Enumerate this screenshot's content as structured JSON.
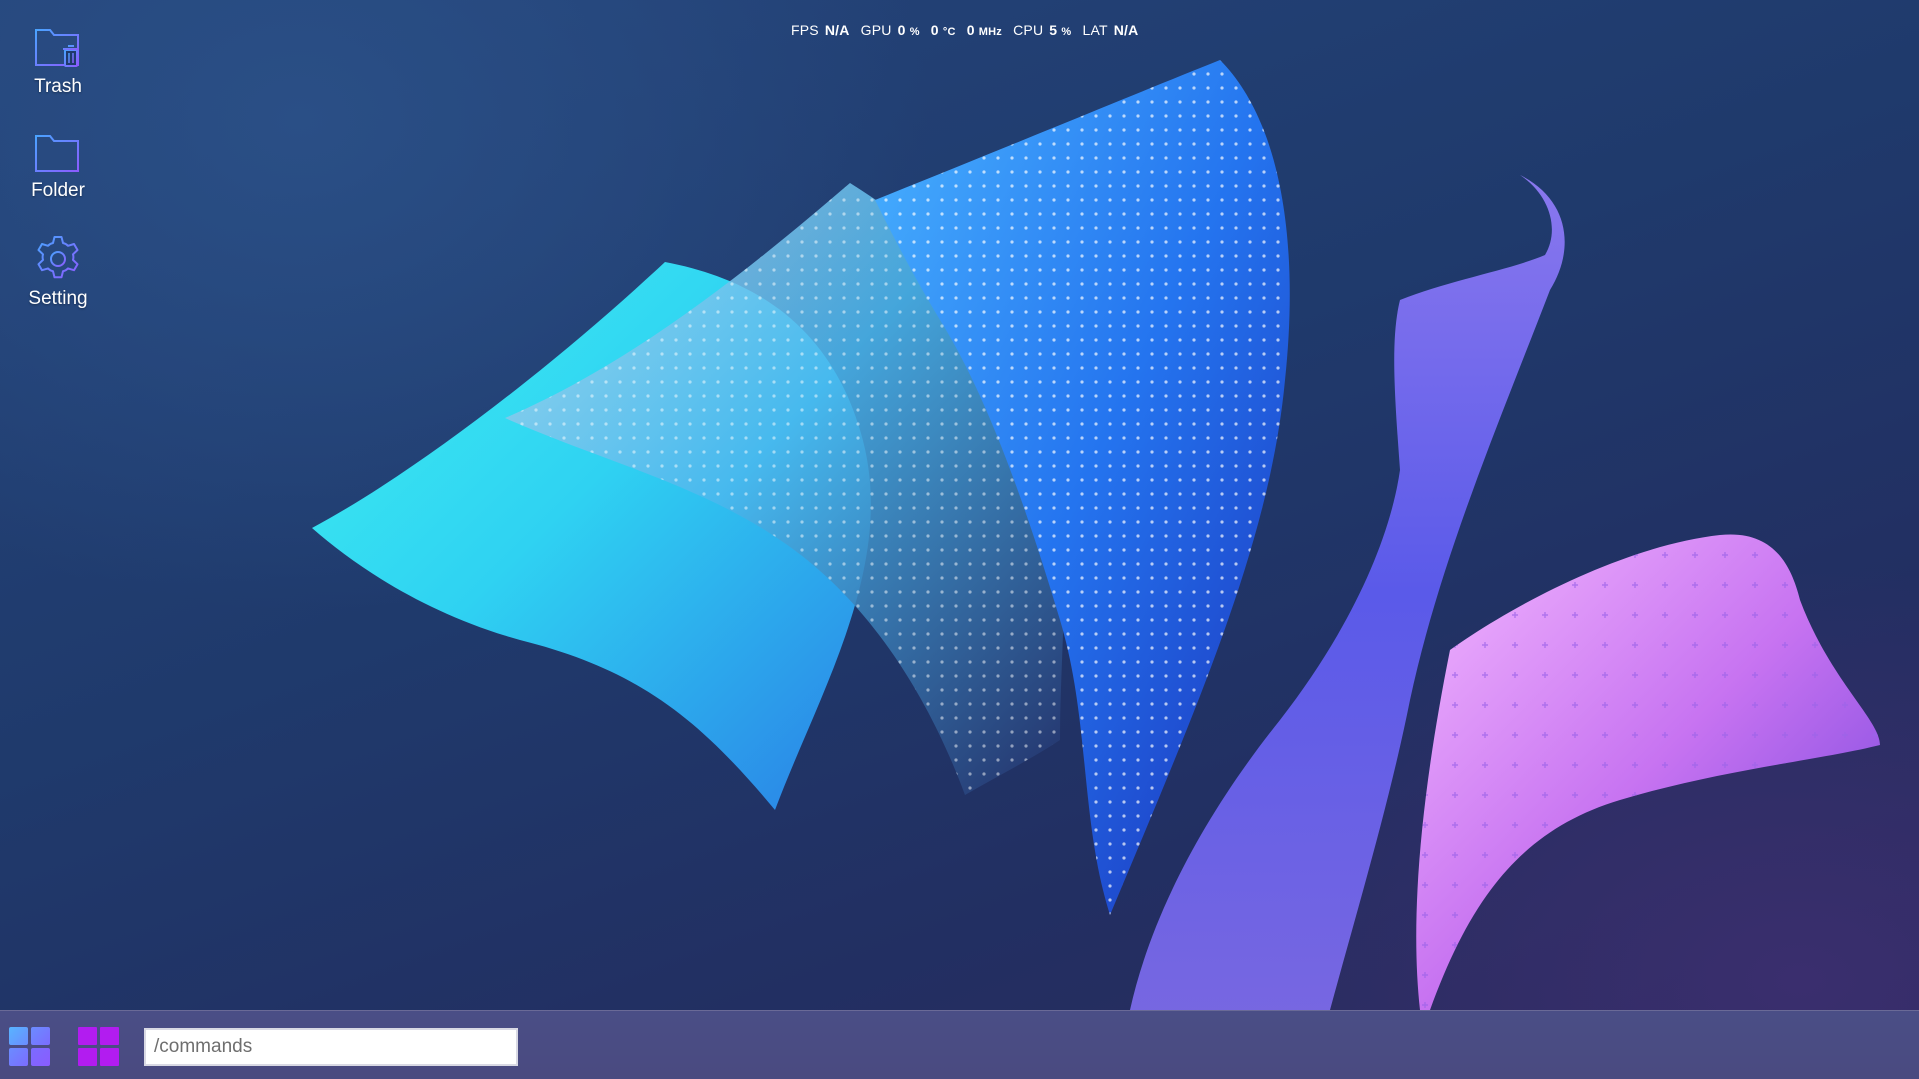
{
  "desktop": {
    "icons": [
      {
        "label": "Trash",
        "icon": "trash-folder-icon"
      },
      {
        "label": "Folder",
        "icon": "folder-icon"
      },
      {
        "label": "Setting",
        "icon": "gear-icon"
      }
    ]
  },
  "perf": {
    "fps_label": "FPS",
    "fps_value": "N/A",
    "gpu_label": "GPU",
    "gpu_usage": "0",
    "gpu_usage_unit": "%",
    "gpu_temp": "0",
    "gpu_temp_unit": "°C",
    "gpu_clock": "0",
    "gpu_clock_unit": "MHz",
    "cpu_label": "CPU",
    "cpu_usage": "5",
    "cpu_usage_unit": "%",
    "lat_label": "LAT",
    "lat_value": "N/A"
  },
  "taskbar": {
    "start_icon": "windows-grid-icon",
    "app_icon": "app-grid-icon",
    "command_placeholder": "/commands",
    "command_value": ""
  },
  "colors": {
    "icon_gradient_start": "#4aa3ff",
    "icon_gradient_end": "#8a5cff",
    "start_tile": "#6f8cff",
    "app_tile": "#b21cf0"
  }
}
